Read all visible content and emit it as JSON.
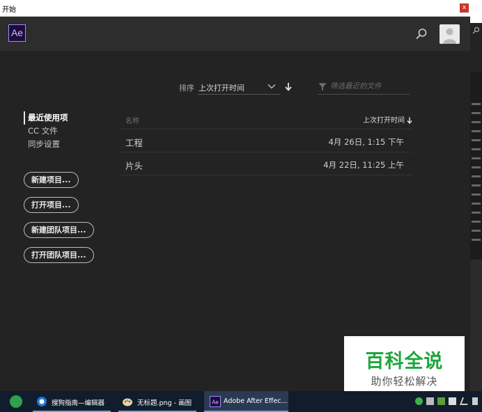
{
  "window": {
    "title": "开始",
    "close_label": "x"
  },
  "header": {
    "logo_text": "Ae",
    "search_icon": "search-icon",
    "avatar_icon": "user-avatar-icon"
  },
  "nav": {
    "items": [
      {
        "label": "最近使用项",
        "active": true
      },
      {
        "label": "CC 文件",
        "active": false
      },
      {
        "label": "同步设置",
        "active": false
      }
    ]
  },
  "actions": {
    "new_project": "新建项目...",
    "open_project": "打开项目...",
    "new_team_project": "新建团队项目...",
    "open_team_project": "打开团队项目..."
  },
  "sort": {
    "label": "排序",
    "selected": "上次打开时间",
    "direction_icon": "arrow-down-icon"
  },
  "filter": {
    "placeholder": "筛选最近的文件",
    "value": "",
    "icon": "filter-funnel-icon"
  },
  "table": {
    "columns": {
      "name": "名称",
      "last_opened": "上次打开时间"
    },
    "rows": [
      {
        "name": "工程",
        "opened": "4月 26日, 1:15 下午"
      },
      {
        "name": "片头",
        "opened": "4月 22日, 11:25 上午"
      }
    ]
  },
  "watermark": {
    "main": "百科全说",
    "sub": "助你轻松解决"
  },
  "taskbar": {
    "items": [
      {
        "label": "搜狗指南—编辑器",
        "icon": "browser-icon"
      },
      {
        "label": "无标题.png - 画图",
        "icon": "paint-icon"
      },
      {
        "label": "Adobe After Effec...",
        "icon": "after-effects-icon"
      }
    ]
  },
  "colors": {
    "ae_purple": "#9b8cff",
    "dialog_bg": "#232323",
    "header_bg": "#2d2d2d",
    "watermark_green": "#1ca63c",
    "taskbar_bg": "#111d2c"
  }
}
